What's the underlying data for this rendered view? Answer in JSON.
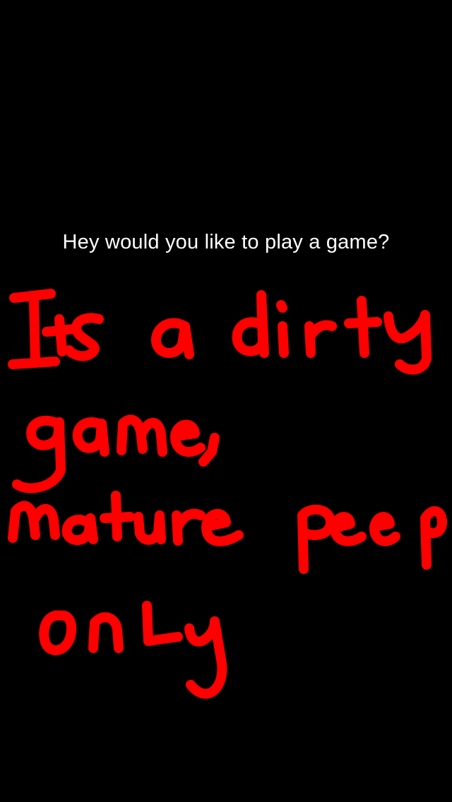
{
  "caption": {
    "text": "Hey would you like to play a game?"
  },
  "drawing": {
    "stroke_color": "#ff0000",
    "text_lines": [
      "Its a dirty",
      "game,",
      "mature peep",
      "only"
    ]
  },
  "colors": {
    "background": "#000000",
    "caption_text": "#ffffff",
    "drawing": "#ff0000"
  }
}
